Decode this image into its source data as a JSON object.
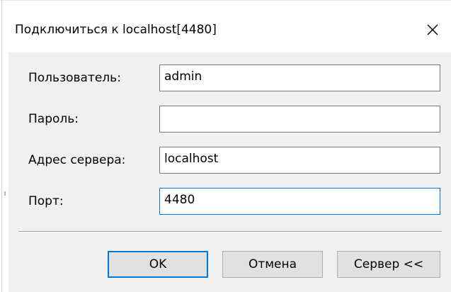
{
  "dialog": {
    "title": "Подключиться к localhost[4480]"
  },
  "form": {
    "user_label": "Пользователь:",
    "user_value": "admin",
    "password_label": "Пароль:",
    "password_value": "",
    "server_label": "Адрес сервера:",
    "server_value": "localhost",
    "port_label": "Порт:",
    "port_value": "4480"
  },
  "buttons": {
    "ok_label": "OK",
    "cancel_label": "Отмена",
    "server_label": "Сервер <<"
  },
  "icons": {
    "close": "close-icon"
  },
  "colors": {
    "dialog_bg": "#f0f0f0",
    "focus_border": "#0078d7",
    "button_bg": "#e1e1e1"
  }
}
